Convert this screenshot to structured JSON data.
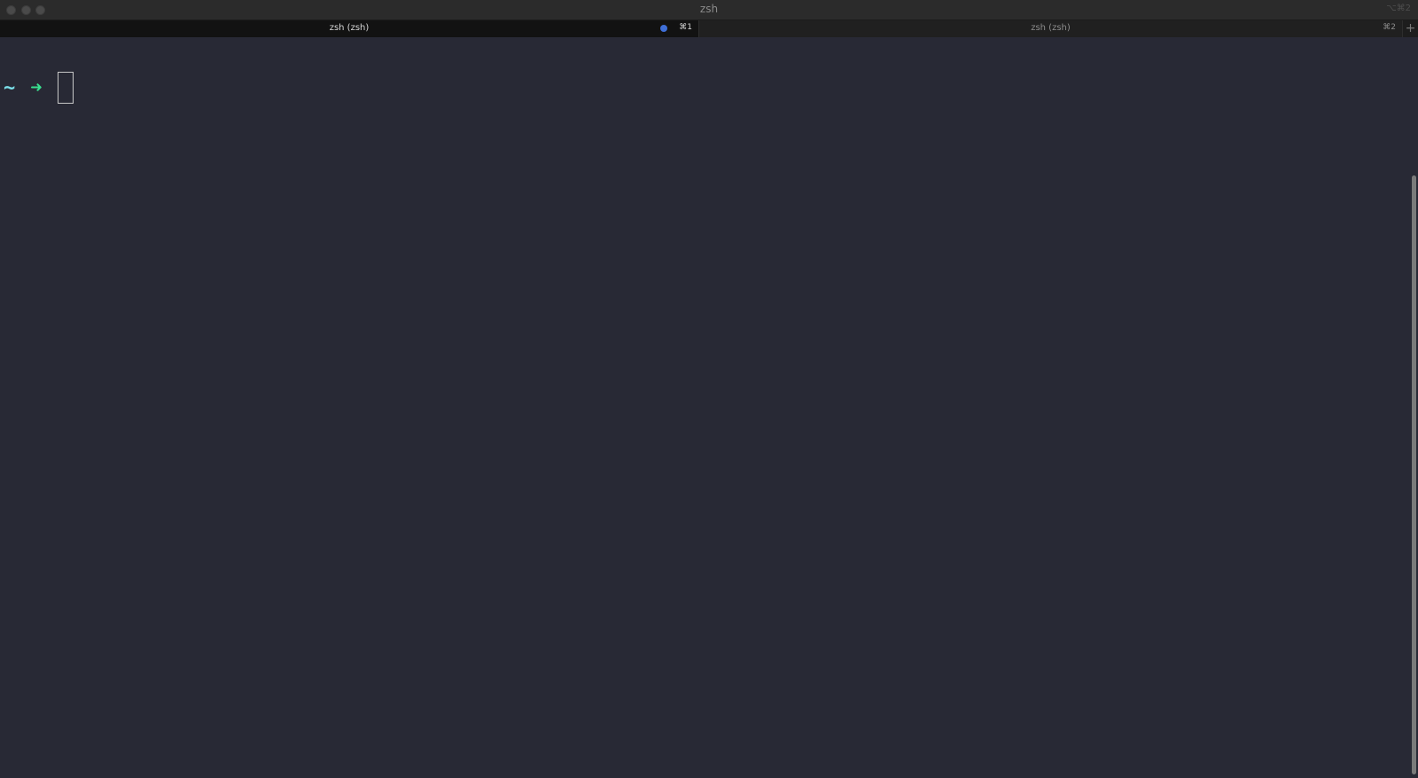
{
  "window": {
    "title": "zsh",
    "title_shortcut": "⌥⌘2"
  },
  "tabs": [
    {
      "label": "zsh (zsh)",
      "shortcut": "⌘1",
      "active": true,
      "indicator_color": "#3f6fd8"
    },
    {
      "label": "zsh (zsh)",
      "shortcut": "⌘2",
      "active": false
    }
  ],
  "new_tab": {
    "label": "+"
  },
  "terminal": {
    "prompt_dir": "~",
    "prompt_symbol": "➜",
    "input_value": "",
    "colors": {
      "background": "#282935",
      "dir": "#7be0ea",
      "arrow": "#39e08f"
    }
  },
  "scrollbar": {
    "thumb_position": 0.83,
    "visible_fraction": 0.81
  }
}
